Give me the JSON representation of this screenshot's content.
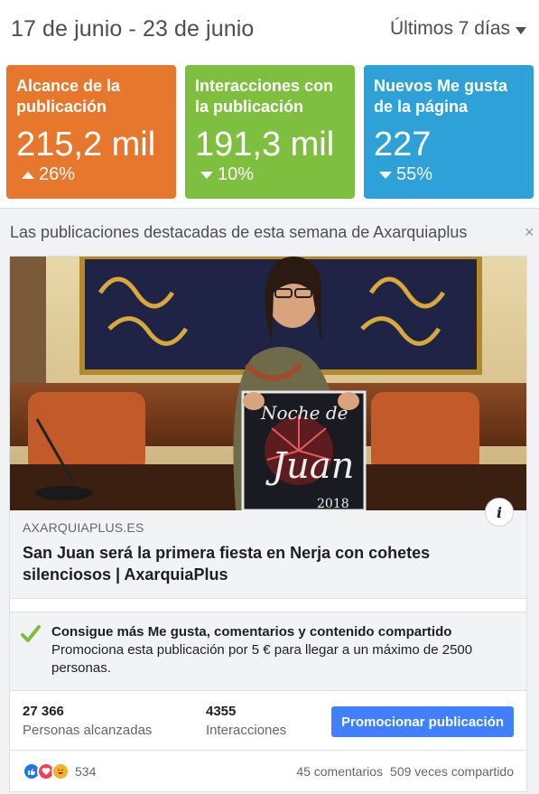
{
  "header": {
    "date_range": "17 de junio - 23 de junio",
    "period": "Últimos 7 días"
  },
  "stats": [
    {
      "title": "Alcance de la publicación",
      "value": "215,2 mil",
      "change": "26%",
      "direction": "up",
      "color": "#e8772e"
    },
    {
      "title": "Interacciones con la publicación",
      "value": "191,3 mil",
      "change": "10%",
      "direction": "down",
      "color": "#7fbf3f"
    },
    {
      "title": "Nuevos Me gusta de la página",
      "value": "227",
      "change": "55%",
      "direction": "down",
      "color": "#2ea2d8"
    }
  ],
  "panel": {
    "title": "Las publicaciones destacadas de esta semana de Axarquiaplus",
    "close": "×"
  },
  "post": {
    "image_icon": "info-icon",
    "info_label": "i",
    "domain": "AXARQUIAPLUS.ES",
    "title": "San Juan será la primera fiesta en Nerja con cohetes silenciosos | AxarquiaPlus"
  },
  "promo": {
    "icon": "check-icon",
    "title": "Consigue más Me gusta, comentarios y contenido compartido",
    "text": "Promociona esta publicación por 5 € para llegar a un máximo de 2500 personas."
  },
  "metrics": {
    "reached_value": "27 366",
    "reached_label": "Personas alcanzadas",
    "interactions_value": "4355",
    "interactions_label": "Interacciones",
    "promote_button": "Promocionar publicación"
  },
  "reactions": {
    "count": "534",
    "comments": "45 comentarios",
    "shares": "509 veces compartido"
  },
  "colors": {
    "accent": "#4080ff",
    "orange": "#e8772e",
    "green": "#7fbf3f",
    "blue": "#2ea2d8"
  }
}
